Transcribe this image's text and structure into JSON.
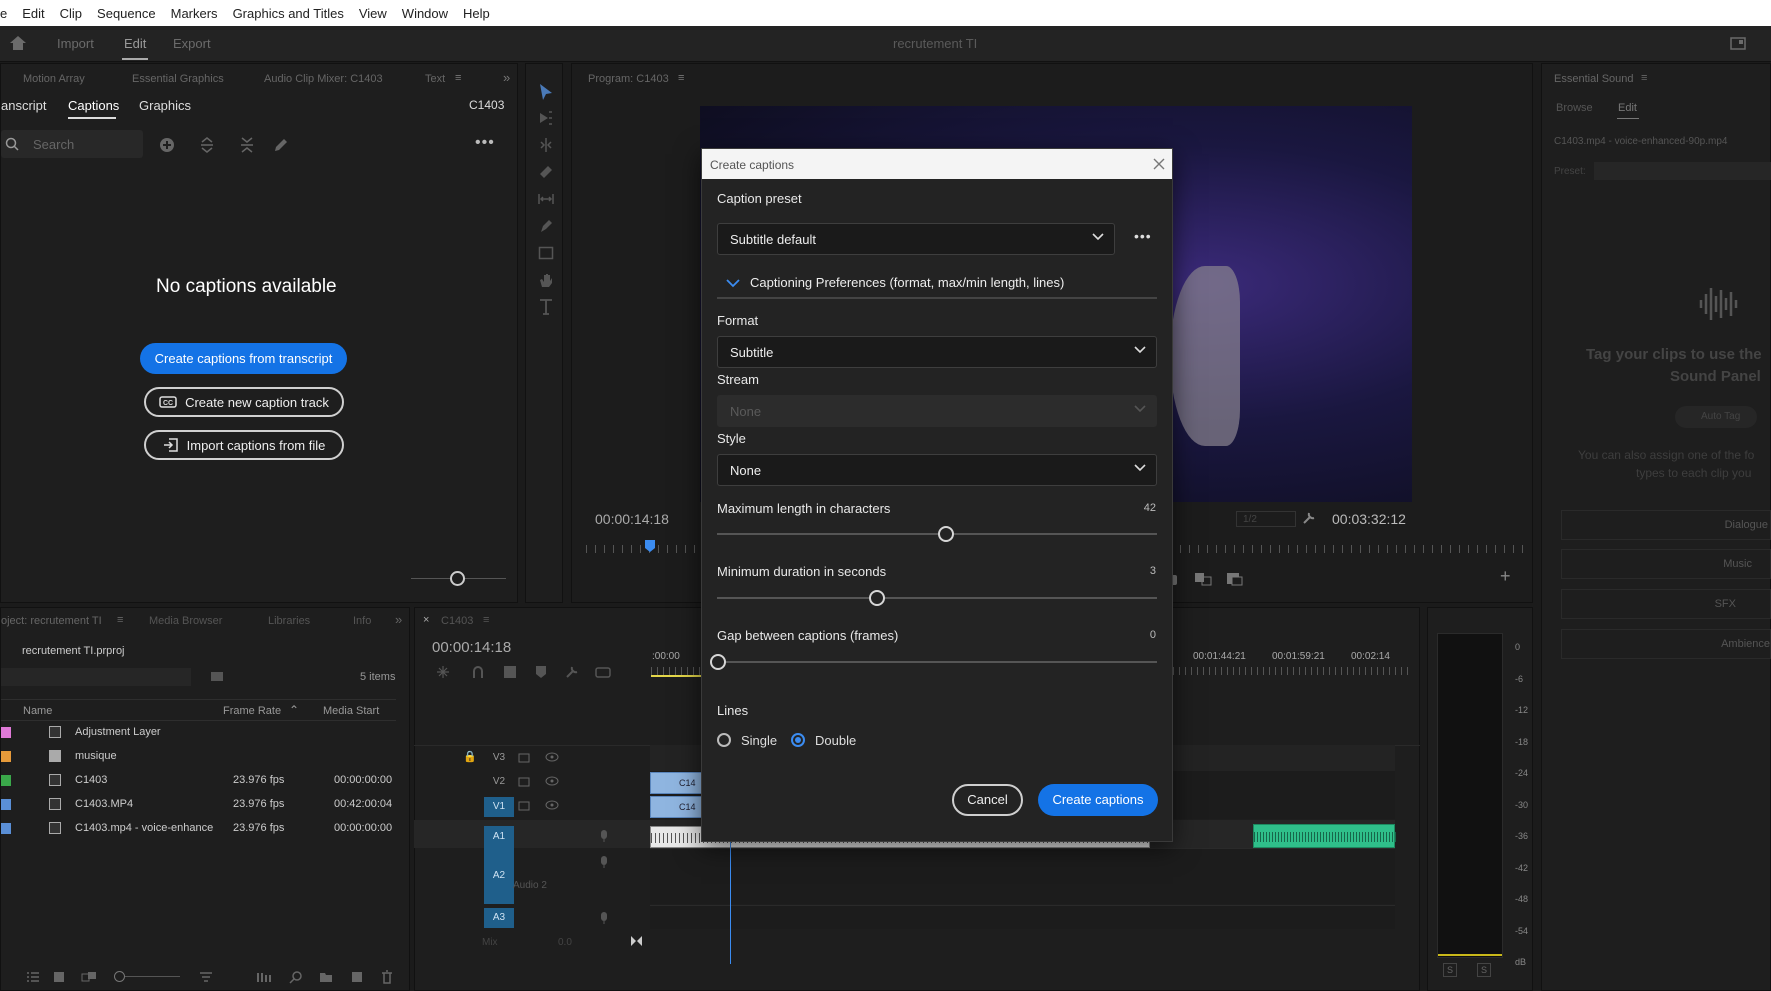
{
  "menubar": {
    "items": [
      "e",
      "Edit",
      "Clip",
      "Sequence",
      "Markers",
      "Graphics and Titles",
      "View",
      "Window",
      "Help"
    ]
  },
  "appbar": {
    "import": "Import",
    "edit": "Edit",
    "export": "Export",
    "project_title": "recrutement TI"
  },
  "text_panel": {
    "tabs": [
      "Motion Array",
      "Essential Graphics",
      "Audio Clip Mixer: C1403",
      "Text"
    ],
    "subtabs": [
      "anscript",
      "Captions",
      "Graphics"
    ],
    "sequence": "C1403",
    "search_placeholder": "Search",
    "empty_title": "No captions available",
    "create_from_transcript": "Create captions from transcript",
    "create_track": "Create new caption track",
    "import_file": "Import captions from file"
  },
  "program": {
    "title": "Program: C1403",
    "timecode_left": "00:00:14:18",
    "timecode_right": "00:03:32:12",
    "zoom": "1/2"
  },
  "essential_sound": {
    "title": "Essential Sound",
    "tabs": [
      "Browse",
      "Edit"
    ],
    "clip": "C1403.mp4 - voice-enhanced-90p.mp4",
    "preset_label": "Preset:",
    "tag_text_1": "Tag your clips to use the",
    "tag_text_2": "Sound Panel",
    "auto_tag": "Auto Tag",
    "assign_1": "You can also assign one of the fo",
    "assign_2": "types to each clip you",
    "types": [
      "Dialogue",
      "Music",
      "SFX",
      "Ambience"
    ]
  },
  "project": {
    "tabs": [
      "oject: recrutement TI",
      "Media Browser",
      "Libraries",
      "Info"
    ],
    "file": "recrutement TI.prproj",
    "count": "5 items",
    "columns": [
      "Name",
      "Frame Rate",
      "Media Start"
    ],
    "rows": [
      {
        "name": "Adjustment Layer",
        "rate": "",
        "start": "",
        "color": "#e07ad8"
      },
      {
        "name": "musique",
        "rate": "",
        "start": "",
        "color": "#e69a3a"
      },
      {
        "name": "C1403",
        "rate": "23.976 fps",
        "start": "00:00:00:00",
        "color": "#3aa84a"
      },
      {
        "name": "C1403.MP4",
        "rate": "23.976 fps",
        "start": "00:42:00:04",
        "color": "#5a8fd6"
      },
      {
        "name": "C1403.mp4 - voice-enhance",
        "rate": "23.976 fps",
        "start": "00:00:00:00",
        "color": "#5a8fd6"
      }
    ]
  },
  "timeline": {
    "tab": "C1403",
    "timecode": "00:00:14:18",
    "ruler": [
      ":00:00",
      "00:01:44:21",
      "00:01:59:21",
      "00:02:14"
    ],
    "tracks": [
      "V3",
      "V2",
      "V1",
      "A1",
      "A2",
      "A3"
    ],
    "audio2_label": "Audio 2",
    "mix_label": "Mix",
    "mix_value": "0.0",
    "clip_label": "C14"
  },
  "meter": {
    "ticks": [
      "0",
      "-6",
      "-12",
      "-18",
      "-24",
      "-30",
      "-36",
      "-42",
      "-48",
      "-54",
      "dB"
    ],
    "solo": [
      "S",
      "S"
    ]
  },
  "dialog": {
    "title": "Create captions",
    "caption_preset_label": "Caption preset",
    "preset_value": "Subtitle default",
    "prefs_label": "Captioning Preferences (format, max/min length, lines)",
    "format_label": "Format",
    "format_value": "Subtitle",
    "stream_label": "Stream",
    "stream_value": "None",
    "style_label": "Style",
    "style_value": "None",
    "max_len_label": "Maximum length in characters",
    "max_len_value": "42",
    "min_dur_label": "Minimum duration in seconds",
    "min_dur_value": "3",
    "gap_label": "Gap between captions (frames)",
    "gap_value": "0",
    "lines_label": "Lines",
    "single": "Single",
    "double": "Double",
    "cancel": "Cancel",
    "create": "Create captions"
  },
  "colors": {
    "accent": "#1473e6",
    "track_label": "#1f5f8b",
    "audio_clip": "#2fbf8a"
  }
}
